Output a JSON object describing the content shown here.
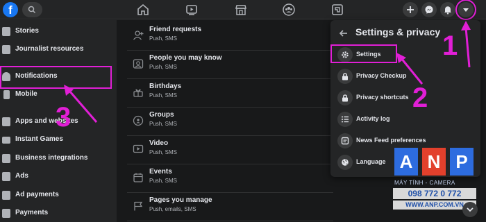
{
  "sidebar": {
    "items": [
      {
        "label": "Stories",
        "icon": "stories-icon"
      },
      {
        "label": "Journalist resources",
        "icon": "journalist-icon"
      },
      {
        "label": "Notifications",
        "icon": "bell-icon"
      },
      {
        "label": "Mobile",
        "icon": "mobile-icon"
      },
      {
        "label": "Apps and websites",
        "icon": "apps-icon"
      },
      {
        "label": "Instant Games",
        "icon": "games-icon"
      },
      {
        "label": "Business integrations",
        "icon": "business-icon"
      },
      {
        "label": "Ads",
        "icon": "ads-icon"
      },
      {
        "label": "Ad payments",
        "icon": "ad-payments-icon"
      },
      {
        "label": "Payments",
        "icon": "payments-icon"
      }
    ]
  },
  "notifications": {
    "items": [
      {
        "title": "Friend requests",
        "sub": "Push, SMS"
      },
      {
        "title": "People you may know",
        "sub": "Push, SMS"
      },
      {
        "title": "Birthdays",
        "sub": "Push, SMS"
      },
      {
        "title": "Groups",
        "sub": "Push, SMS"
      },
      {
        "title": "Video",
        "sub": "Push, SMS"
      },
      {
        "title": "Events",
        "sub": "Push, SMS"
      },
      {
        "title": "Pages you manage",
        "sub": "Push, emails, SMS"
      }
    ]
  },
  "dropdown": {
    "title": "Settings & privacy",
    "items": [
      {
        "label": "Settings",
        "icon": "gear-icon"
      },
      {
        "label": "Privacy Checkup",
        "icon": "lock-icon"
      },
      {
        "label": "Privacy shortcuts",
        "icon": "lock-icon"
      },
      {
        "label": "Activity log",
        "icon": "list-icon"
      },
      {
        "label": "News Feed preferences",
        "icon": "feed-icon"
      },
      {
        "label": "Language",
        "icon": "globe-icon"
      }
    ]
  },
  "annotations": {
    "one": "1",
    "two": "2",
    "three": "3"
  },
  "watermark": {
    "letters": [
      "A",
      "N",
      "P"
    ],
    "line1": "MÁY TÍNH - CAMERA",
    "phone": "098 772 0 772",
    "url": "WWW.ANP.COM.VN"
  },
  "colors": {
    "accent": "#e11fd6",
    "brand": "#1877f2",
    "bg": "#18191a",
    "panel": "#242526"
  }
}
